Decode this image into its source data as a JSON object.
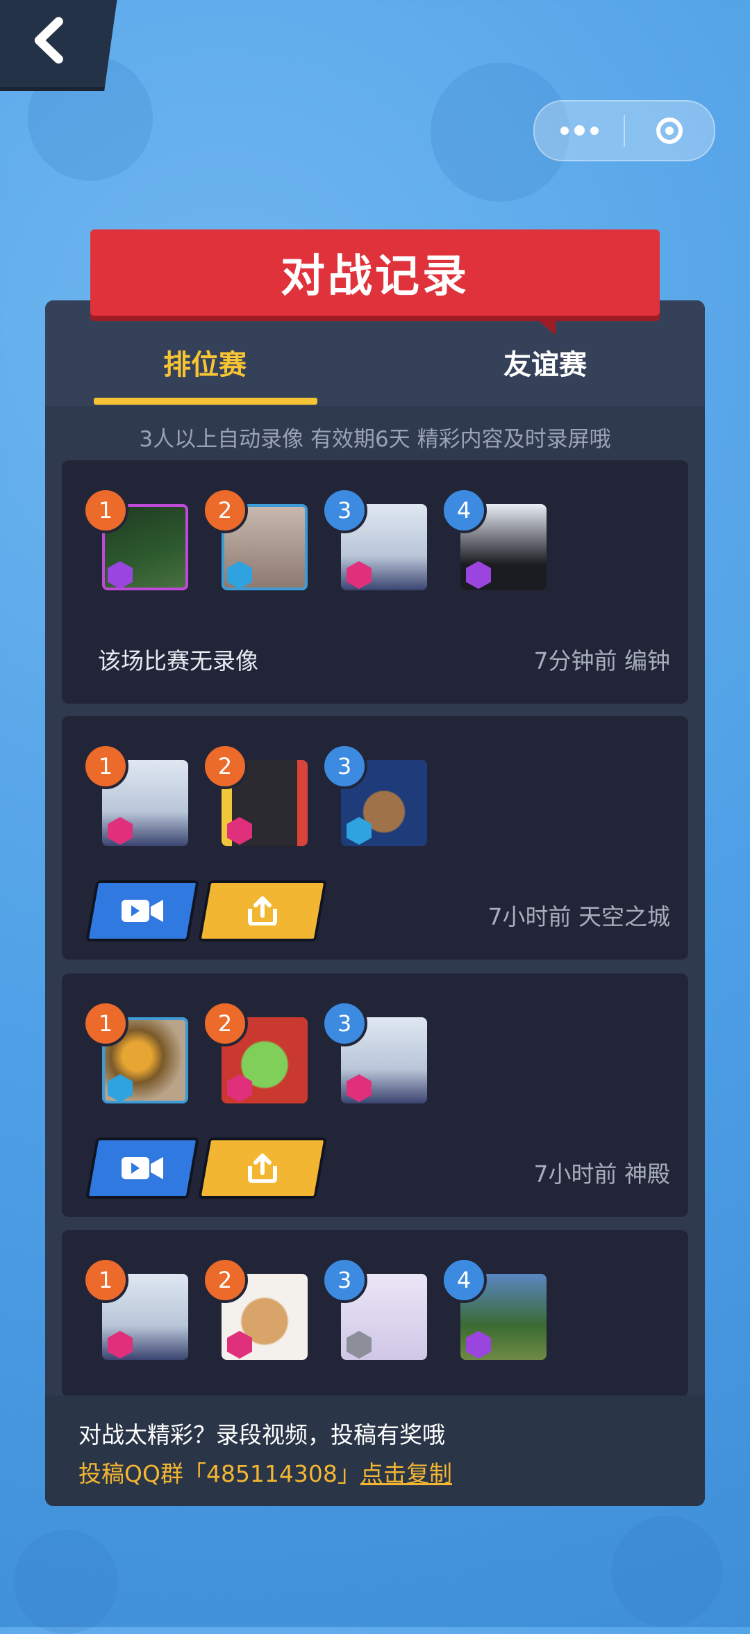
{
  "title": "对战记录",
  "tabs": [
    {
      "label": "排位赛",
      "active": true
    },
    {
      "label": "友谊赛",
      "active": false
    }
  ],
  "hint": "3人以上自动录像 有效期6天 精彩内容及时录屏哦",
  "colors": {
    "accent": "#f6c434",
    "banner": "#e0323b",
    "video_button": "#2f79e0",
    "share_button": "#f3b632"
  },
  "matches": [
    {
      "players": [
        {
          "rank": "1",
          "tier_icon": "purple-gem-icon"
        },
        {
          "rank": "2",
          "tier_icon": "blue-gem-icon"
        },
        {
          "rank": "3",
          "tier_icon": "pink-gem-icon"
        },
        {
          "rank": "4",
          "tier_icon": "purple-gem-icon"
        }
      ],
      "no_video_text": "该场比赛无录像",
      "meta": "7分钟前 编钟"
    },
    {
      "players": [
        {
          "rank": "1",
          "tier_icon": "pink-gem-icon"
        },
        {
          "rank": "2",
          "tier_icon": "pink-gem-icon"
        },
        {
          "rank": "3",
          "tier_icon": "blue-gem-icon"
        }
      ],
      "meta": "7小时前 天空之城",
      "buttons": [
        "video-camera-icon",
        "share-upload-icon"
      ]
    },
    {
      "players": [
        {
          "rank": "1",
          "tier_icon": "blue-gem-icon"
        },
        {
          "rank": "2",
          "tier_icon": "pink-gem-icon"
        },
        {
          "rank": "3",
          "tier_icon": "pink-gem-icon"
        }
      ],
      "meta": "7小时前 神殿",
      "buttons": [
        "video-camera-icon",
        "share-upload-icon"
      ]
    },
    {
      "players": [
        {
          "rank": "1",
          "tier_icon": "pink-gem-icon"
        },
        {
          "rank": "2",
          "tier_icon": "pink-gem-icon"
        },
        {
          "rank": "3",
          "tier_icon": "gray-gem-icon"
        },
        {
          "rank": "4",
          "tier_icon": "purple-gem-icon"
        }
      ]
    }
  ],
  "footer": {
    "line1": "对战太精彩？录段视频，投稿有奖哦",
    "line2_prefix": "投稿QQ群「485114308」",
    "copy_link": "点击复制"
  }
}
